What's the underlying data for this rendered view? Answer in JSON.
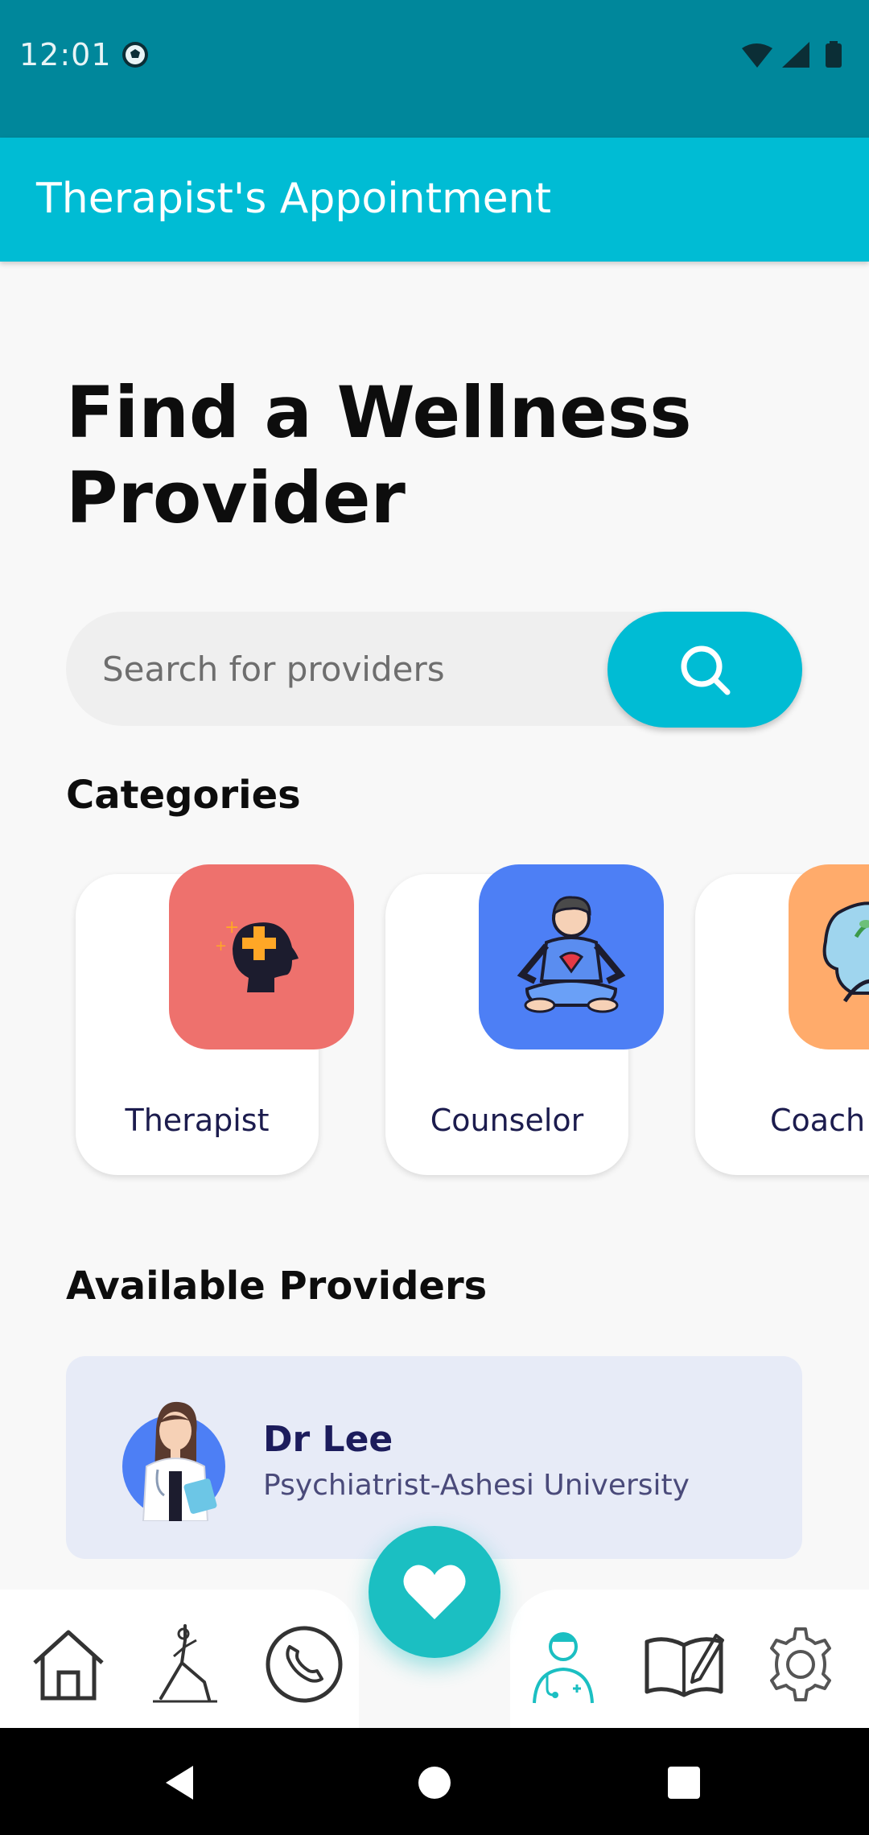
{
  "status_bar": {
    "time": "12:01"
  },
  "app_bar": {
    "title": "Therapist's Appointment"
  },
  "page": {
    "heading": "Find a Wellness Provider"
  },
  "search": {
    "placeholder": "Search for providers"
  },
  "categories": {
    "title": "Categories",
    "items": [
      {
        "label": "Therapist",
        "icon": "head-medical-icon",
        "color": "#ee716d"
      },
      {
        "label": "Counselor",
        "icon": "meditation-icon",
        "color": "#4d7ff5"
      },
      {
        "label": "Coach",
        "icon": "mind-growth-icon",
        "color": "#ffab6b"
      }
    ]
  },
  "providers": {
    "title": "Available Providers",
    "items": [
      {
        "name": "Dr Lee",
        "role": "Psychiatrist-Ashesi University"
      }
    ]
  },
  "bottom_nav": {
    "items": [
      "home-icon",
      "yoga-icon",
      "phone-icon",
      "doctor-icon",
      "journal-icon",
      "settings-icon"
    ],
    "fab": "heart-icon",
    "active": "doctor-icon"
  },
  "colors": {
    "accent": "#00bcd4",
    "status_bar": "#00879b",
    "fab": "#1bbfc2"
  }
}
